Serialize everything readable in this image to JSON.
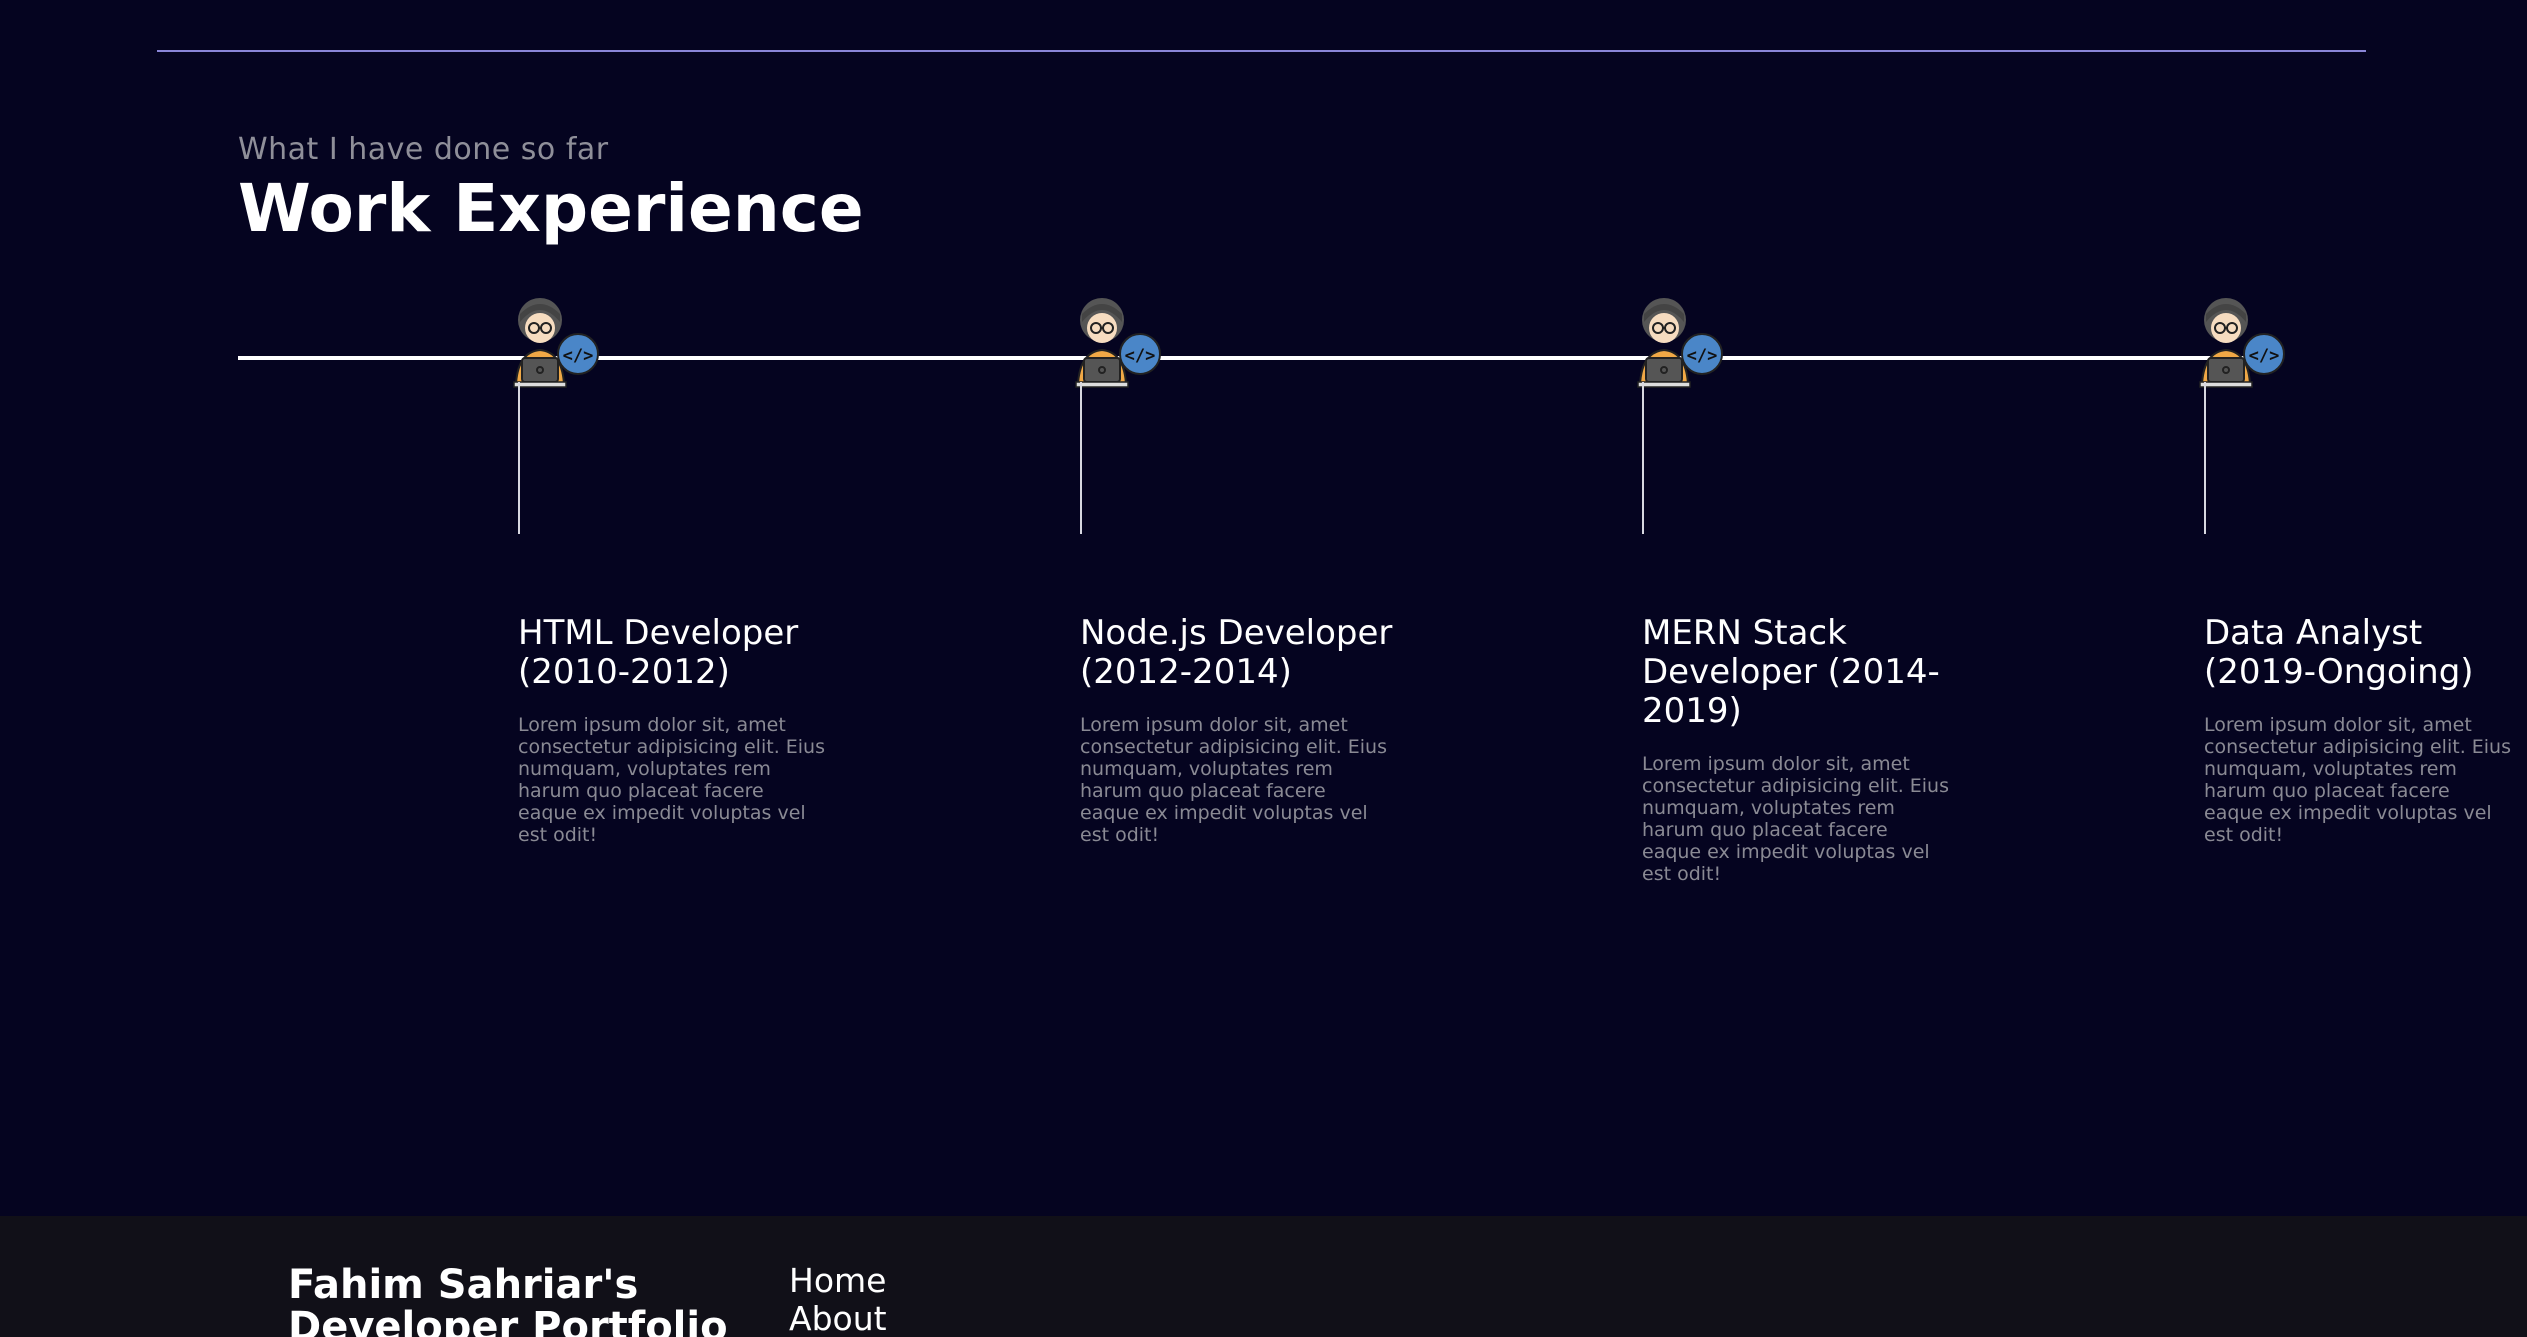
{
  "section": {
    "subtitle": "What I have done so far",
    "heading": "Work Experience"
  },
  "experiences": [
    {
      "title": "HTML Developer (2010-2012)",
      "description": "Lorem ipsum dolor sit, amet consectetur adipisicing elit. Eius numquam, voluptates rem harum quo placeat facere eaque ex impedit voluptas vel est odit!",
      "icon": "developer-avatar-icon"
    },
    {
      "title": "Node.js Developer (2012-2014)",
      "description": "Lorem ipsum dolor sit, amet consectetur adipisicing elit. Eius numquam, voluptates rem harum quo placeat facere eaque ex impedit voluptas vel est odit!",
      "icon": "developer-avatar-icon"
    },
    {
      "title": "MERN Stack Developer (2014-2019)",
      "description": "Lorem ipsum dolor sit, amet consectetur adipisicing elit. Eius numquam, voluptates rem harum quo placeat facere eaque ex impedit voluptas vel est odit!",
      "icon": "developer-avatar-icon"
    },
    {
      "title": "Data Analyst (2019-Ongoing)",
      "description": "Lorem ipsum dolor sit, amet consectetur adipisicing elit. Eius numquam, voluptates rem harum quo placeat facere eaque ex impedit voluptas vel est odit!",
      "icon": "developer-avatar-icon"
    }
  ],
  "footer": {
    "brand": "Fahim Sahriar's Developer Portfolio",
    "links": [
      "Home",
      "About"
    ]
  },
  "colors": {
    "background": "#050420",
    "footer_background": "#111018",
    "rule": "#8a86d8",
    "muted_text": "#8a8a94",
    "code_badge": "#4a86c8",
    "shirt": "#f0a846"
  }
}
